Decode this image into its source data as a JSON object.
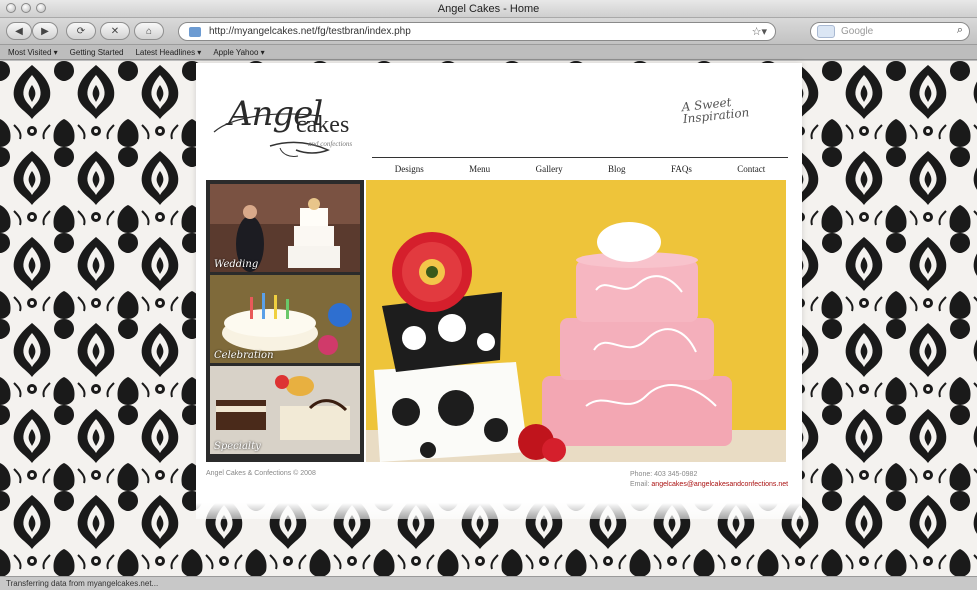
{
  "window": {
    "title": "Angel Cakes - Home"
  },
  "toolbar": {
    "url": "http://myangelcakes.net/fg/testbran/index.php",
    "search_placeholder": "Google"
  },
  "bookmarks": [
    "Most Visited ▾",
    "Getting Started",
    "Latest Headlines ▾",
    "Apple Yahoo ▾"
  ],
  "site": {
    "logo_word1": "Angel",
    "logo_word2": "cakes",
    "logo_sub": "and confections",
    "tagline": "A Sweet Inspiration",
    "nav": [
      "Designs",
      "Menu",
      "Gallery",
      "Blog",
      "FAQs",
      "Contact"
    ],
    "thumbs": [
      {
        "label": "Wedding"
      },
      {
        "label": "Celebration"
      },
      {
        "label": "Specialty"
      }
    ],
    "footer_copyright": "Angel Cakes & Confections © 2008",
    "footer_phone": "Phone: 403 345-0982",
    "footer_email_label": "Email:",
    "footer_email": "angelcakes@angelcakesandconfections.net"
  },
  "status": {
    "text": "Transferring data from myangelcakes.net..."
  },
  "colors": {
    "hero_yellow": "#eec43a",
    "pink_cake": "#f3a7b3",
    "accent_red": "#d51f2c"
  }
}
